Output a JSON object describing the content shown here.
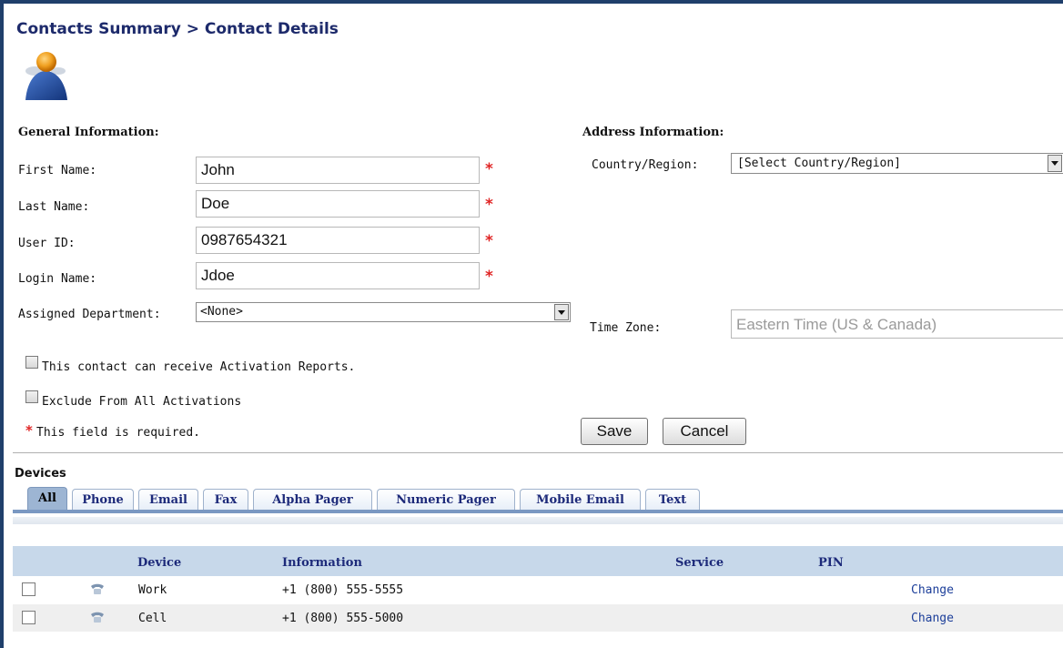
{
  "breadcrumb": {
    "parent": "Contacts Summary",
    "separator": " > ",
    "current": "Contact Details"
  },
  "avatar_icon": "person-icon",
  "general": {
    "title": "General Information:",
    "first_name": {
      "label": "First Name:",
      "value": "John"
    },
    "last_name": {
      "label": "Last Name:",
      "value": "Doe"
    },
    "user_id": {
      "label": "User ID:",
      "value": "0987654321"
    },
    "login_name": {
      "label": "Login Name:",
      "value": "Jdoe"
    },
    "required_mark": "*",
    "department": {
      "label": "Assigned Department:",
      "value": "<None>"
    },
    "activation_reports": {
      "label": "This contact can receive Activation Reports.",
      "checked": false
    },
    "exclude_activations": {
      "label": "Exclude From All Activations",
      "checked": false
    },
    "required_note": "This field is required."
  },
  "address": {
    "title": "Address Information:",
    "country": {
      "label": "Country/Region:",
      "value": "[Select Country/Region]"
    },
    "time_zone": {
      "label": "Time Zone:",
      "value": "Eastern Time (US & Canada)"
    }
  },
  "actions": {
    "save": "Save",
    "cancel": "Cancel"
  },
  "devices": {
    "title": "Devices",
    "tabs": [
      "All",
      "Phone",
      "Email",
      "Fax",
      "Alpha Pager",
      "Numeric Pager",
      "Mobile Email",
      "Text"
    ],
    "active_tab": "All",
    "columns": {
      "device": "Device",
      "information": "Information",
      "service": "Service",
      "pin": "PIN"
    },
    "rows": [
      {
        "device": "Work",
        "information": "+1 (800) 555-5555",
        "service": "",
        "pin": "",
        "action": "Change",
        "icon": "phone-icon"
      },
      {
        "device": "Cell",
        "information": "+1 (800) 555-5000",
        "service": "",
        "pin": "",
        "action": "Change",
        "icon": "phone-icon"
      }
    ]
  },
  "colors": {
    "frame": "#1f3f6b",
    "title": "#1d2a6b",
    "required": "#e02525",
    "tab_active": "#9db5d3",
    "table_header": "#c7d8ea",
    "row_alt": "#efefef",
    "link": "#1d3f9a"
  }
}
